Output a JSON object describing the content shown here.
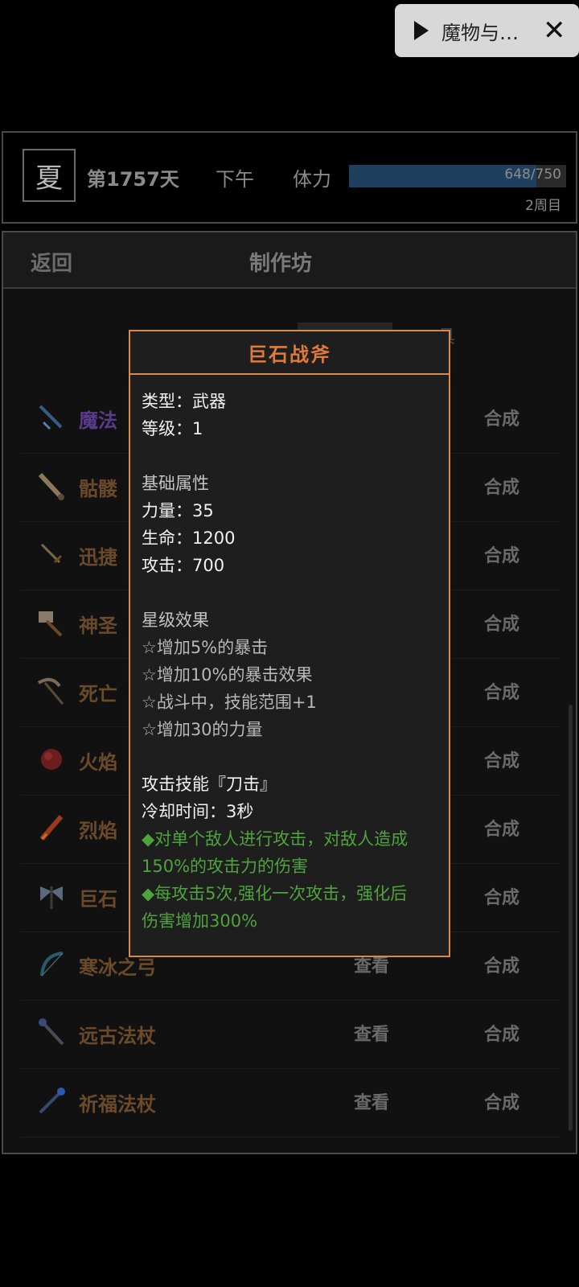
{
  "mini_player": {
    "title": "魔物与…"
  },
  "status": {
    "season": "夏",
    "day": "第1757天",
    "period": "下午",
    "stamina_label": "体力",
    "stamina_current": 648,
    "stamina_max": 750,
    "stamina_text": "648/750",
    "round": "2周目"
  },
  "panel": {
    "back_label": "返回",
    "title": "制作坊",
    "partial_tab_text": "具"
  },
  "items": [
    {
      "name": "魔法",
      "name_color": "#5a3a8a",
      "view": "",
      "craft": "合成"
    },
    {
      "name": "骷髅",
      "name_color": "#6b4a2a",
      "view": "",
      "craft": "合成"
    },
    {
      "name": "迅捷",
      "name_color": "#6b4a2a",
      "view": "",
      "craft": "合成"
    },
    {
      "name": "神圣",
      "name_color": "#6b4a2a",
      "view": "",
      "craft": "合成"
    },
    {
      "name": "死亡",
      "name_color": "#6b4a2a",
      "view": "",
      "craft": "合成"
    },
    {
      "name": "火焰",
      "name_color": "#6b4a2a",
      "view": "",
      "craft": "合成"
    },
    {
      "name": "烈焰",
      "name_color": "#6b4a2a",
      "view": "",
      "craft": "合成"
    },
    {
      "name": "巨石",
      "name_color": "#6b4a2a",
      "view": "",
      "craft": "合成"
    },
    {
      "name": "寒冰之弓",
      "name_color": "#6b4a2a",
      "view": "查看",
      "craft": "合成"
    },
    {
      "name": "远古法杖",
      "name_color": "#6b4a2a",
      "view": "查看",
      "craft": "合成"
    },
    {
      "name": "祈福法杖",
      "name_color": "#6b4a2a",
      "view": "查看",
      "craft": "合成"
    }
  ],
  "tooltip": {
    "title": "巨石战斧",
    "type_line": "类型：武器",
    "level_line": "等级：1",
    "base_heading": "基础属性",
    "base_stats": [
      "力量：35",
      "生命：1200",
      "攻击：700"
    ],
    "star_heading": "星级效果",
    "star_effects": [
      "☆增加5%的暴击",
      "☆增加10%的暴击效果",
      "☆战斗中，技能范围+1",
      "☆增加30的力量"
    ],
    "skill_line": "攻击技能『刀击』",
    "cooldown_line": "冷却时间：3秒",
    "skill_desc_1": "◆对单个敌人进行攻击，对敌人造成",
    "skill_desc_1b": "150%的攻击力的伤害",
    "skill_desc_2": "◆每攻击5次,强化一次攻击，强化后",
    "skill_desc_2b": "伤害增加300%"
  }
}
